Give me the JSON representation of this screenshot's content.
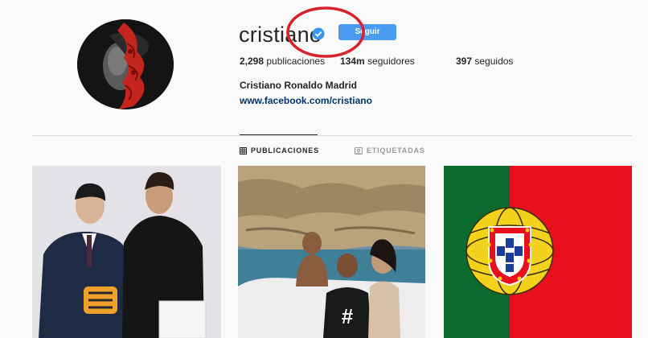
{
  "profile": {
    "username": "cristiano",
    "follow_label": "Seguir",
    "stats": {
      "posts_count": "2,298",
      "posts_label": "publicaciones",
      "followers_count": "134m",
      "followers_label": "seguidores",
      "following_count": "397",
      "following_label": "seguidos"
    },
    "full_name": "Cristiano Ronaldo Madrid",
    "website": "www.facebook.com/cristiano"
  },
  "tabs": [
    {
      "label": "PUBLICACIONES",
      "icon": "grid-icon",
      "active": true
    },
    {
      "label": "ETIQUETADAS",
      "icon": "tag-icon",
      "active": false
    }
  ],
  "posts": [
    {
      "subject": "two-men-posing-photo"
    },
    {
      "subject": "family-boat-cliffs-photo",
      "jersey_text": "#"
    },
    {
      "subject": "portugal-flag"
    }
  ],
  "colors": {
    "follow_button": "#4a9cf0",
    "verified_badge": "#3897f0",
    "annotation_circle": "#d9212a",
    "flag_green": "#0b6b2e",
    "flag_red": "#e8101c",
    "flag_yellow": "#f2d21a"
  }
}
